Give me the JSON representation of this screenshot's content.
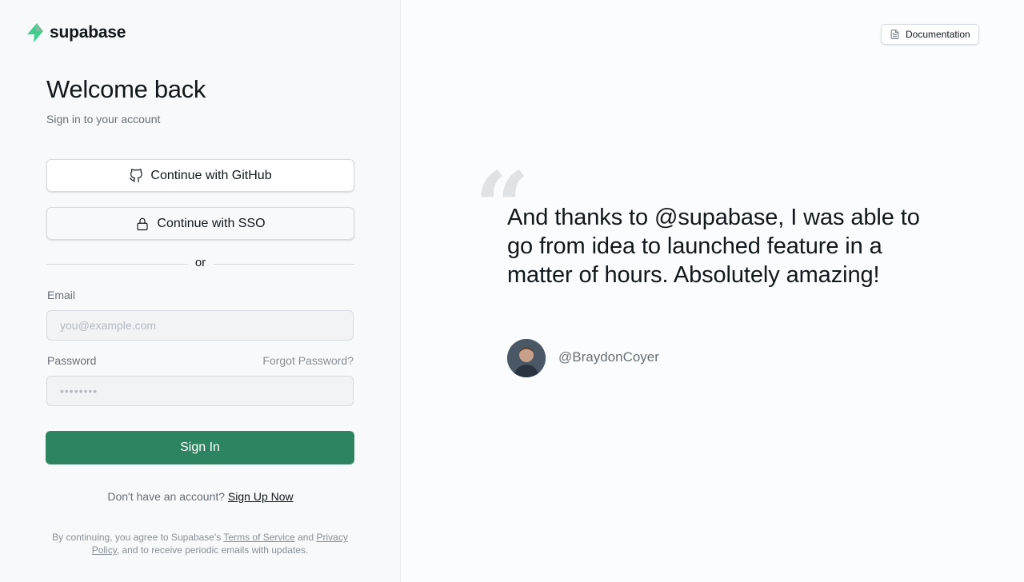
{
  "brand": {
    "name": "supabase",
    "accent": "#3ecf8e"
  },
  "login": {
    "title": "Welcome back",
    "subtitle": "Sign in to your account",
    "github_label": "Continue with GitHub",
    "sso_label": "Continue with SSO",
    "divider": "or",
    "email_label": "Email",
    "email_placeholder": "you@example.com",
    "password_label": "Password",
    "forgot_label": "Forgot Password?",
    "password_placeholder": "••••••••",
    "signin_label": "Sign In",
    "signin_color": "#2c8460",
    "no_account": "Don't have an account?",
    "signup_label": "Sign Up Now",
    "terms_prefix": "By continuing, you agree to Supabase's",
    "terms_link": "Terms of Service",
    "terms_and": "and",
    "privacy_link": "Privacy Policy",
    "terms_suffix": ", and to receive periodic emails with updates."
  },
  "header": {
    "doc_label": "Documentation",
    "doc_icon": "document-icon"
  },
  "testimonial": {
    "quote": "And thanks to @supabase, I was able to go from idea to launched feature in a matter of hours. Absolutely amazing!",
    "handle": "@BraydonCoyer"
  }
}
